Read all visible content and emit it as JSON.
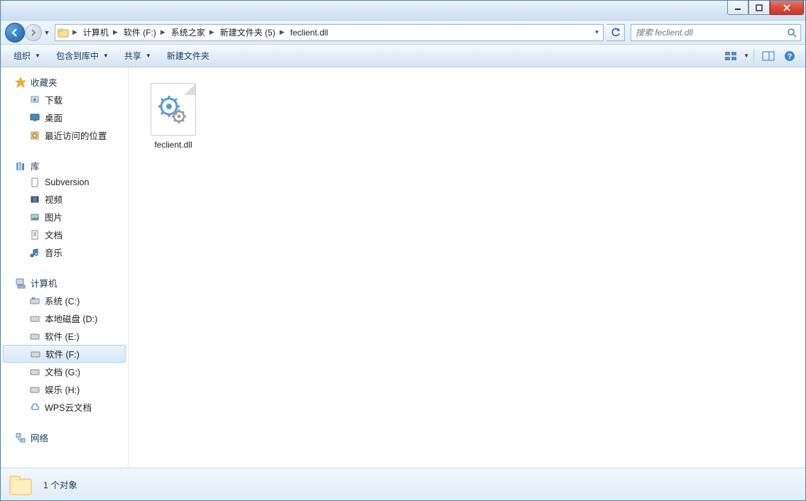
{
  "breadcrumb": {
    "items": [
      "计算机",
      "软件 (F:)",
      "系统之家",
      "新建文件夹 (5)",
      "feclient.dll"
    ]
  },
  "search": {
    "placeholder": "搜索 feclient.dll"
  },
  "toolbar": {
    "organize": "组织",
    "include": "包含到库中",
    "share": "共享",
    "newfolder": "新建文件夹"
  },
  "sidebar": {
    "favorites": {
      "label": "收藏夹",
      "items": [
        "下载",
        "桌面",
        "最近访问的位置"
      ]
    },
    "libraries": {
      "label": "库",
      "items": [
        "Subversion",
        "视频",
        "图片",
        "文档",
        "音乐"
      ]
    },
    "computer": {
      "label": "计算机",
      "items": [
        "系统 (C:)",
        "本地磁盘 (D:)",
        "软件 (E:)",
        "软件 (F:)",
        "文档 (G:)",
        "娱乐 (H:)",
        "WPS云文档"
      ]
    },
    "network": {
      "label": "网络"
    }
  },
  "files": {
    "items": [
      {
        "name": "feclient.dll"
      }
    ]
  },
  "status": {
    "text": "1 个对象"
  }
}
